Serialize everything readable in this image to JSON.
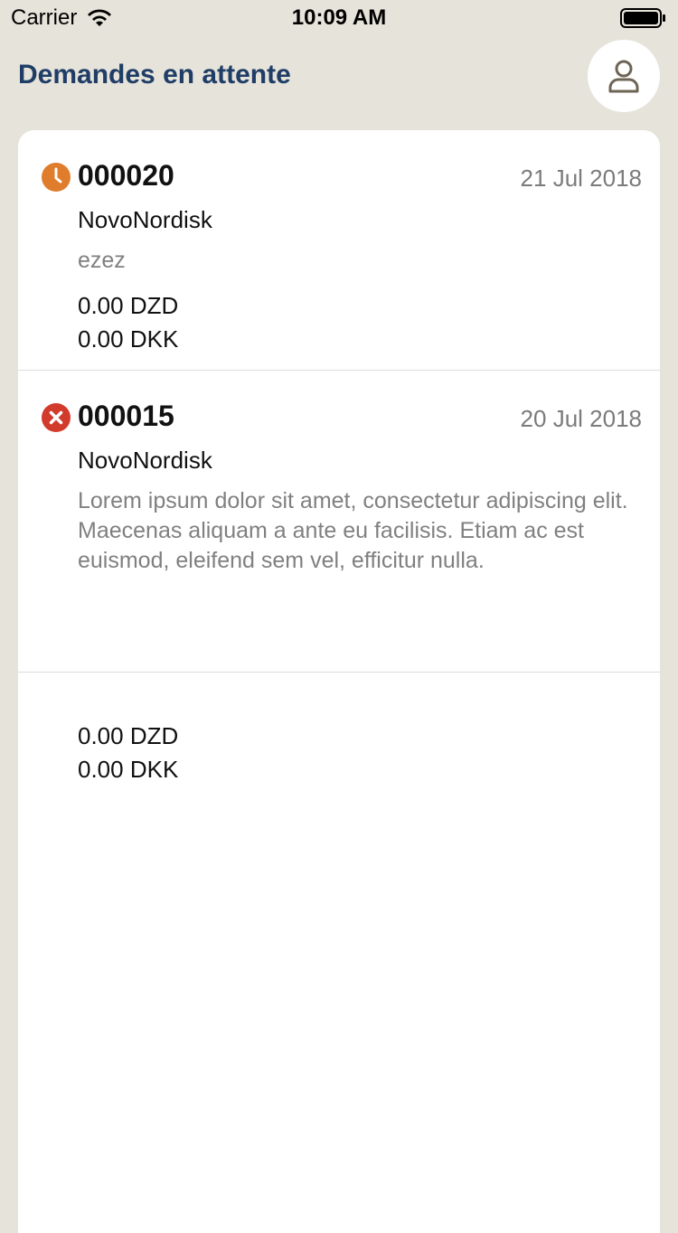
{
  "status_bar": {
    "carrier": "Carrier",
    "time": "10:09 AM"
  },
  "header": {
    "title": "Demandes en attente"
  },
  "colors": {
    "title": "#1f3d66",
    "pending": "#e07d2c",
    "rejected": "#d23b2b",
    "background": "#e6e3da"
  },
  "requests": [
    {
      "status": "clock-icon",
      "id": "000020",
      "date": "21 Jul 2018",
      "company": "NovoNordisk",
      "description": "ezez",
      "amount_1": "0.00 DZD",
      "amount_2": "0.00 DKK"
    },
    {
      "status": "close-circle-icon",
      "id": "000015",
      "date": "20 Jul 2018",
      "company": "NovoNordisk",
      "description": "Lorem ipsum dolor sit amet, consectetur adipiscing elit. Maecenas aliquam a ante eu facilisis. Etiam ac est euismod, eleifend sem vel, efficitur nulla.",
      "amount_1": "0.00 DZD",
      "amount_2": "0.00 DKK"
    }
  ]
}
